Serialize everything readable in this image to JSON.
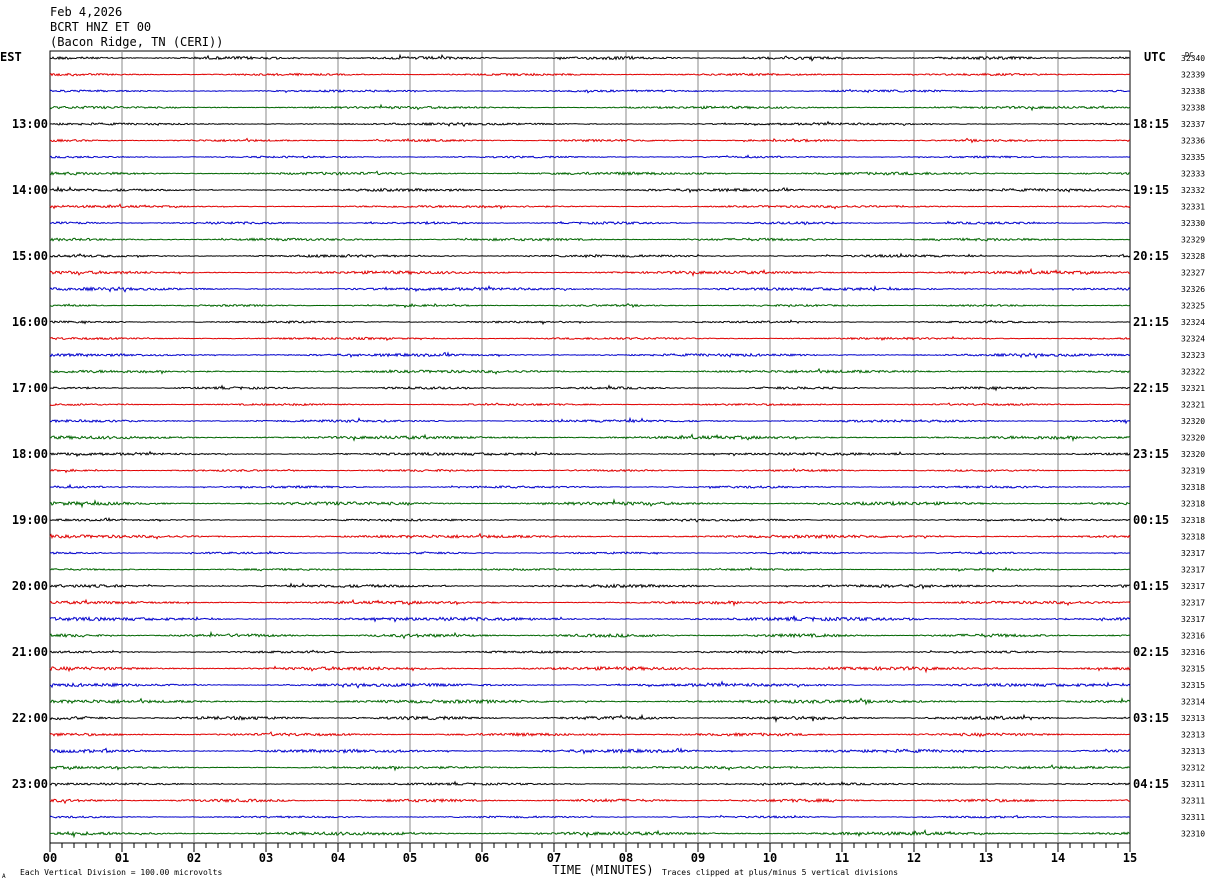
{
  "header": {
    "date": "Feb 4,2026",
    "station": "BCRT HNZ ET 00",
    "location": "(Bacon Ridge, TN (CERI))"
  },
  "chart_data": {
    "type": "line",
    "left_timezone_label": "EST",
    "right_timezone_label": "UTC",
    "dc_label": "DC",
    "xlabel": "TIME (MINUTES)",
    "x_tick_labels": [
      "00",
      "01",
      "02",
      "03",
      "04",
      "05",
      "06",
      "07",
      "08",
      "09",
      "10",
      "11",
      "12",
      "13",
      "14",
      "15"
    ],
    "xlim": [
      0,
      15
    ],
    "left_hour_labels": [
      "13:00",
      "14:00",
      "15:00",
      "16:00",
      "17:00",
      "18:00",
      "19:00",
      "20:00",
      "21:00",
      "22:00",
      "23:00"
    ],
    "right_hour_labels": [
      "18:15",
      "19:15",
      "20:15",
      "21:15",
      "22:15",
      "23:15",
      "00:15",
      "01:15",
      "02:15",
      "03:15",
      "04:15"
    ],
    "trace_count": 48,
    "trace_colors": [
      "#000000",
      "#e00000",
      "#0000cc",
      "#006600"
    ],
    "dc_offsets": [
      32340,
      32339,
      32338,
      32338,
      32337,
      32336,
      32335,
      32333,
      32332,
      32331,
      32330,
      32329,
      32328,
      32327,
      32326,
      32325,
      32324,
      32324,
      32323,
      32322,
      32321,
      32321,
      32320,
      32320,
      32320,
      32319,
      32318,
      32318,
      32318,
      32318,
      32317,
      32317,
      32317,
      32317,
      32317,
      32316,
      32316,
      32315,
      32315,
      32314,
      32313,
      32313,
      32313,
      32312,
      32311,
      32311,
      32311,
      32310
    ],
    "footer_left": "Each Vertical Division =  100.00 microvolts",
    "footer_right": "Traces clipped at plus/minus 5 vertical divisions",
    "footer_mark": "A"
  }
}
